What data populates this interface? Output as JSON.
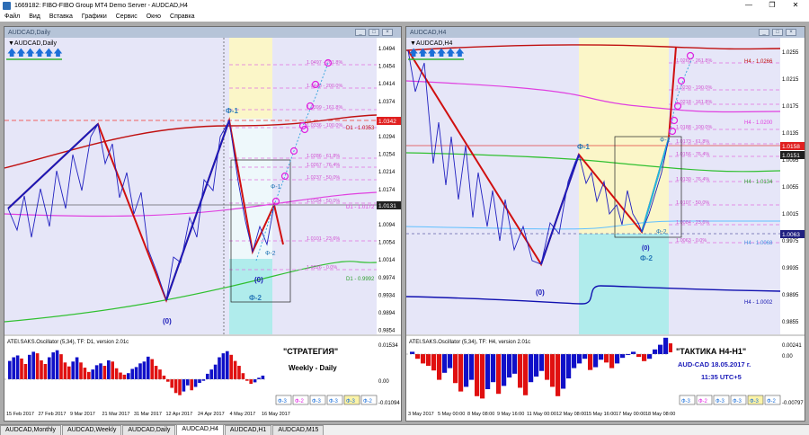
{
  "app": {
    "title": "1669182: FIBO-FIBO Group MT4 Demo Server - AUDCAD,H4"
  },
  "window_controls": {
    "minimize": "—",
    "restore": "❐",
    "close": "✕"
  },
  "menu": [
    "Файл",
    "Вид",
    "Вставка",
    "Графики",
    "Сервис",
    "Окно",
    "Справка"
  ],
  "left_chart": {
    "window_title": "AUDCAD,Daily",
    "symbol_label": "▼AUDCAD,Daily",
    "price_axis": [
      "1.0494",
      "1.0454",
      "1.0414",
      "1.0374",
      "1.0334",
      "1.0294",
      "1.0254",
      "1.0214",
      "1.0174",
      "1.0134",
      "1.0094",
      "1.0054",
      "1.0014",
      "0.9974",
      "0.9934",
      "0.9894",
      "0.9854"
    ],
    "current_price": "1.0131",
    "d1_price": "1.0342",
    "time_axis": [
      "15 Feb 2017",
      "27 Feb 2017",
      "9 Mar 2017",
      "21 Mar 2017",
      "31 Mar 2017",
      "12 Apr 2017",
      "24 Apr 2017",
      "4 May 2017",
      "16 May 2017"
    ],
    "fibo_labels": [
      "1.0497 - 261.8%",
      "1.0448 - 200.0%",
      "1.0399 - 161.8%",
      "1.0336 - 100.0%",
      "1.0286 - 61.8%",
      "1.0267 - 76.4%",
      "1.0237 - 50.0%",
      "1.0184 - 50.0%",
      "1.0101 - 23.6%",
      "1.0026 - 0.0%"
    ],
    "level_labels": [
      "D1 - 1.0353",
      "D1 - 1.0172",
      "D1 - 0.9992"
    ],
    "wave_labels": {
      "f1": "Ф-1",
      "f2": "Ф-2",
      "zero_main": "(0)",
      "zero_small": "(0)",
      "f1_small": "Ф-1",
      "f2_small": "Ф-2"
    },
    "oscillator": {
      "title": "ATEI.SAKS.Oscillator (5,34), TF: D1, version 2.01c",
      "axis": [
        "0.01534",
        "0.00",
        "-0.01094"
      ],
      "values": [
        0.6,
        0.72,
        0.78,
        0.68,
        0.5,
        0.8,
        0.9,
        0.85,
        0.62,
        0.5,
        0.72,
        0.88,
        0.95,
        0.82,
        0.55,
        0.42,
        0.58,
        0.72,
        0.55,
        0.38,
        0.24,
        0.32,
        0.46,
        0.52,
        0.44,
        0.62,
        0.58,
        0.36,
        0.22,
        0.15,
        0.2,
        0.34,
        0.4,
        0.52,
        0.58,
        0.74,
        0.66,
        0.44,
        0.32,
        0.12,
        -0.08,
        -0.28,
        -0.45,
        -0.52,
        -0.4,
        -0.2,
        -0.36,
        -0.25,
        -0.12,
        -0.05,
        0.18,
        0.32,
        0.48,
        0.72,
        0.85,
        0.92,
        0.8,
        0.6,
        0.44,
        0.2,
        -0.05,
        -0.15,
        -0.1,
        0.05,
        0.12
      ],
      "strategy_title": "\"СТРАТЕГИЯ\"",
      "strategy_sub": "Weekly - Daily",
      "buttons": [
        "Ф-3",
        "Ф-2",
        "Ф-3",
        "Ф-3",
        "Ф-3",
        "Ф-2"
      ]
    }
  },
  "right_chart": {
    "window_title": "AUDCAD,H4",
    "symbol_label": "▼AUDCAD,H4",
    "price_axis": [
      "1.0255",
      "1.0215",
      "1.0175",
      "1.0135",
      "1.0095",
      "1.0055",
      "1.0015",
      "0.9975",
      "0.9935",
      "0.9895",
      "0.9855"
    ],
    "current_price": "1.0151",
    "level_price": "1.0158",
    "low_price": "1.0063",
    "time_axis": [
      "3 May 2017",
      "5 May 00:00",
      "8 May 08:00",
      "9 May 16:00",
      "11 May 00:00",
      "12 May 08:00",
      "15 May 16:00",
      "17 May 00:00",
      "18 May 08:00"
    ],
    "fibo_labels": [
      "1.0265 - 261.8%",
      "1.0230 - 190.0%",
      "1.0218 - 161.8%",
      "1.0188 - 100.0%",
      "1.0173 - 61.8%",
      "1.0156 - 76.4%",
      "1.0130 - 76.4%",
      "1.0107 - 50.0%",
      "1.0084 - 23.6%",
      "1.0063 - 0.0%"
    ],
    "level_labels": [
      "H4 - 1.0266",
      "H4 - 1.0200",
      "H4 - 1.0134",
      "H4 - 1.0068",
      "H4 - 1.0002"
    ],
    "wave_labels": {
      "f1": "Ф-1",
      "f2": "Ф-2",
      "zero_main": "(0)",
      "zero_small": "(0)",
      "f1_small": "Ф-1",
      "f2_small": "Ф-2"
    },
    "oscillator": {
      "title": "ATEI.SAKS.Oscillator (5,34), TF: H4, version 2.01c",
      "axis": [
        "0.00241",
        "0.00",
        "-0.00797"
      ],
      "values": [
        0.05,
        -0.1,
        -0.2,
        -0.25,
        -0.35,
        -0.55,
        -0.4,
        -0.3,
        -0.62,
        -0.8,
        -0.7,
        -0.55,
        -0.9,
        -0.95,
        -0.75,
        -0.6,
        -0.85,
        -0.68,
        -0.5,
        -0.42,
        -0.72,
        -0.88,
        -0.6,
        -0.48,
        -0.36,
        -0.55,
        -0.7,
        -0.9,
        -0.74,
        -0.52,
        -0.3,
        -0.2,
        -0.1,
        -0.34,
        -0.28,
        -0.12,
        -0.18,
        -0.3,
        -0.2,
        -0.08,
        -0.02,
        0.05,
        -0.06,
        -0.15,
        -0.1,
        0.1,
        0.2,
        0.35
      ],
      "tactic_title": "\"ТАКТИКА  H4-H1\"",
      "tactic_pair": "AUD-CAD    18.05.2017 г.",
      "tactic_time": "11:35   UTC+5",
      "buttons": [
        "Ф-3",
        "Ф-2",
        "Ф-3",
        "Ф-3",
        "Ф-3",
        "Ф-2"
      ]
    }
  },
  "tabs": [
    "AUDCAD,Monthly",
    "AUDCAD,Weekly",
    "AUDCAD,Daily",
    "AUDCAD,H4",
    "AUDCAD,H1",
    "AUDCAD,M15"
  ],
  "active_tab": "AUDCAD,H4",
  "colors": {
    "bull": "#1010c8",
    "bear": "#e01010",
    "fibo": "#e060e0",
    "zone_yellow": "#fbf6c8",
    "zone_cyan": "#b0ecec",
    "bg": "#e8e8f8"
  }
}
